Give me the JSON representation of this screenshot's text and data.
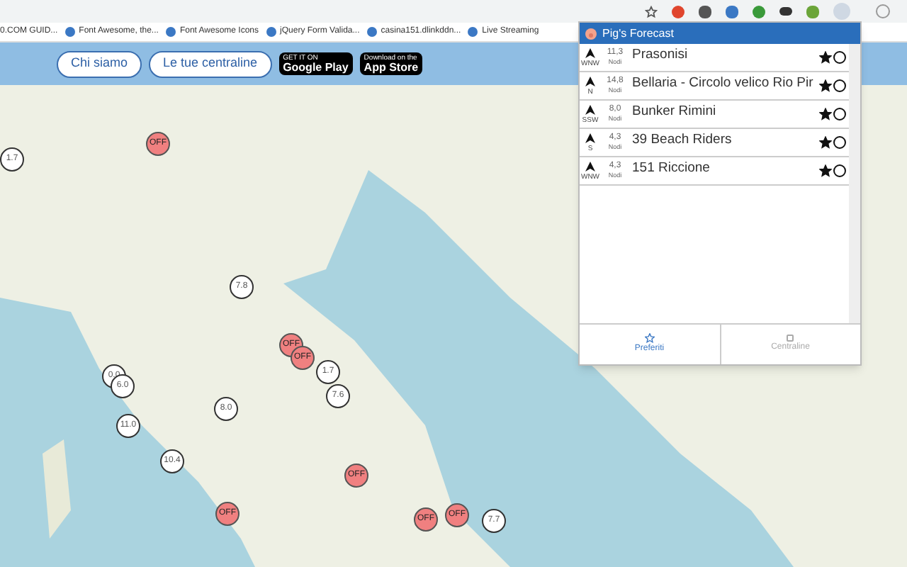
{
  "bookmarks": [
    "0.COM GUID...",
    "Font Awesome, the...",
    "Font Awesome Icons",
    "jQuery Form Valida...",
    "casina151.dlinkddn...",
    "Live Streaming"
  ],
  "header": {
    "buttons": [
      "Chi siamo",
      "Le tue centraline"
    ],
    "stores": [
      {
        "small": "GET IT ON",
        "big": "Google Play"
      },
      {
        "small": "Download on the",
        "big": "App Store"
      }
    ]
  },
  "markers": [
    {
      "kind": "off",
      "text": "OFF"
    },
    {
      "kind": "reading",
      "text": "1.7"
    },
    {
      "kind": "reading",
      "text": "7.8"
    },
    {
      "kind": "off",
      "text": "OFF"
    },
    {
      "kind": "off",
      "text": "OFF"
    },
    {
      "kind": "reading",
      "text": "1.7"
    },
    {
      "kind": "reading",
      "text": "7.6"
    },
    {
      "kind": "reading",
      "text": "0.0"
    },
    {
      "kind": "reading",
      "text": "6.0"
    },
    {
      "kind": "reading",
      "text": "11.0"
    },
    {
      "kind": "reading",
      "text": "8.0"
    },
    {
      "kind": "reading",
      "text": "10.4"
    },
    {
      "kind": "off",
      "text": "OFF"
    },
    {
      "kind": "off",
      "text": "OFF"
    },
    {
      "kind": "off",
      "text": "OFF"
    },
    {
      "kind": "off",
      "text": "OFF"
    },
    {
      "kind": "reading",
      "text": "7.7"
    }
  ],
  "popup": {
    "title": "Pig's Forecast",
    "rows": [
      {
        "dir": "WNW",
        "speed": "11,3",
        "unit": "Nodi",
        "name": "Prasonisi",
        "favorite": true
      },
      {
        "dir": "N",
        "speed": "14,8",
        "unit": "Nodi",
        "name": "Bellaria - Circolo velico Rio Pir",
        "favorite": true
      },
      {
        "dir": "SSW",
        "speed": "8,0",
        "unit": "Nodi",
        "name": "Bunker Rimini",
        "favorite": true
      },
      {
        "dir": "S",
        "speed": "4,3",
        "unit": "Nodi",
        "name": "39 Beach Riders",
        "favorite": true
      },
      {
        "dir": "WNW",
        "speed": "4,3",
        "unit": "Nodi",
        "name": "151 Riccione",
        "favorite": true
      }
    ],
    "tabs": [
      {
        "label": "Preferiti",
        "selected": true
      },
      {
        "label": "Centraline",
        "selected": false
      }
    ]
  }
}
